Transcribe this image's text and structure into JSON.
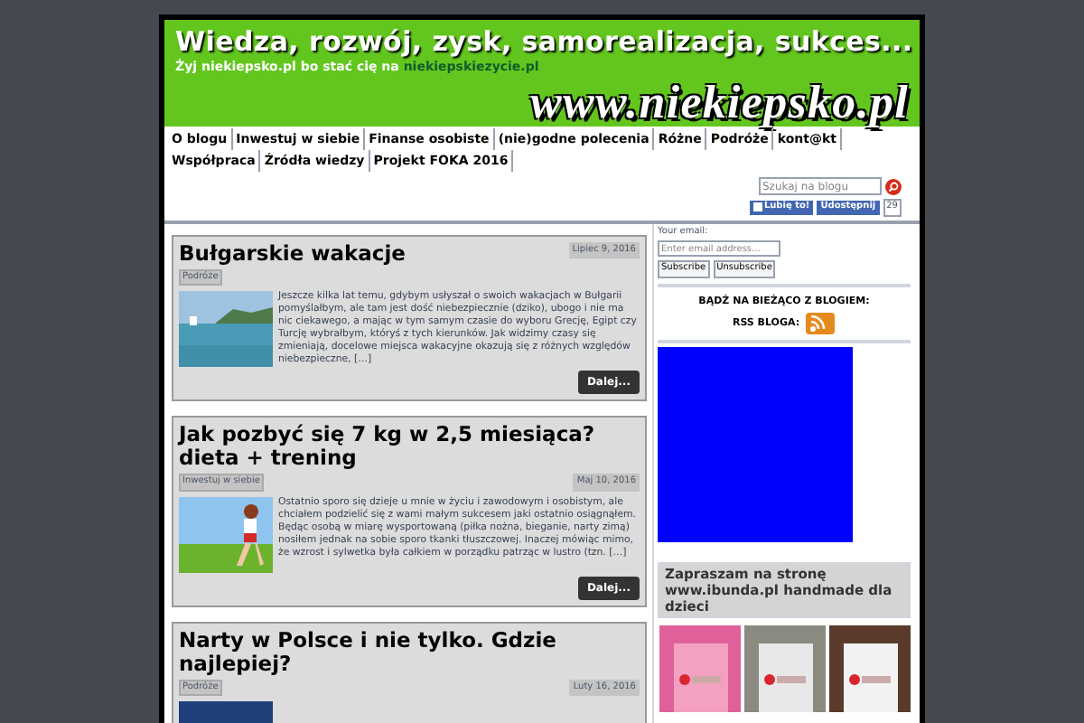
{
  "header": {
    "title": "Wiedza, rozwój, zysk, samorealizacja, sukces...",
    "subtitle": "Żyj niekiepsko.pl bo stać cię na ",
    "subtitle_link": "niekiepskiezycie.pl",
    "logo": "www.niekiepsko.pl"
  },
  "nav": [
    {
      "label": "O blogu"
    },
    {
      "label": "Inwestuj w siebie"
    },
    {
      "label": "Finanse osobiste"
    },
    {
      "label": "(nie)godne polecenia"
    },
    {
      "label": "Różne"
    },
    {
      "label": "Podróże"
    },
    {
      "label": "kont@kt"
    },
    {
      "label": "Współpraca"
    },
    {
      "label": "Źródła wiedzy"
    },
    {
      "label": "Projekt FOKA 2016"
    }
  ],
  "search": {
    "placeholder": "Szukaj na blogu"
  },
  "social": {
    "like": "Lubię to!",
    "share": "Udostępnij",
    "count": "29"
  },
  "posts": [
    {
      "title": "Bułgarskie wakacje",
      "date": "Lipiec 9, 2016",
      "category": "Podróże",
      "excerpt": "Jeszcze kilka lat temu, gdybym usłyszał o swoich wakacjach w Bułgarii pomyślałbym, ale tam jest dość niebezpiecznie (dziko), ubogo i nie ma nic ciekawego, a mając w tym samym czasie do wyboru Grecję, Egipt czy Turcję wybrałbym, któryś z tych kierunków. Jak widzimy czasy się zmieniają, docelowe miejsca wakacyjne okazują się z różnych względów niebezpieczne, […]",
      "button": "Dalej..."
    },
    {
      "title": "Jak pozbyć się 7 kg w 2,5 miesiąca? dieta + trening",
      "date": "Maj 10, 2016",
      "category": "Inwestuj w siebie",
      "excerpt": "Ostatnio sporo się dzieje u mnie w życiu i zawodowym i osobistym, ale chciałem podzielić się z wami małym sukcesem jaki ostatnio osiągnąłem. Będąc osobą w miarę wysportowaną (piłka nożna, bieganie, narty zimą) nosiłem jednak na sobie sporo tkanki tłuszczowej. Inaczej mówiąc mimo, że wzrost i sylwetka była całkiem w porządku patrząc w lustro (tzn. […]",
      "button": "Dalej..."
    },
    {
      "title": "Narty w Polsce i nie tylko. Gdzie najlepiej?",
      "date": "Luty 16, 2016",
      "category": "Podróże"
    }
  ],
  "sidebar": {
    "email_label": "Your email:",
    "email_placeholder": "Enter email address...",
    "buttons": [
      "Subscribe",
      "Unsubscribe"
    ],
    "follow_heading": "BĄDŹ NA BIEŻĄCO Z BLOGIEM:",
    "rss_label": "RSS BLOGA:",
    "promo": "Zapraszam na stronę www.ibunda.pl handmade dla dzieci"
  }
}
